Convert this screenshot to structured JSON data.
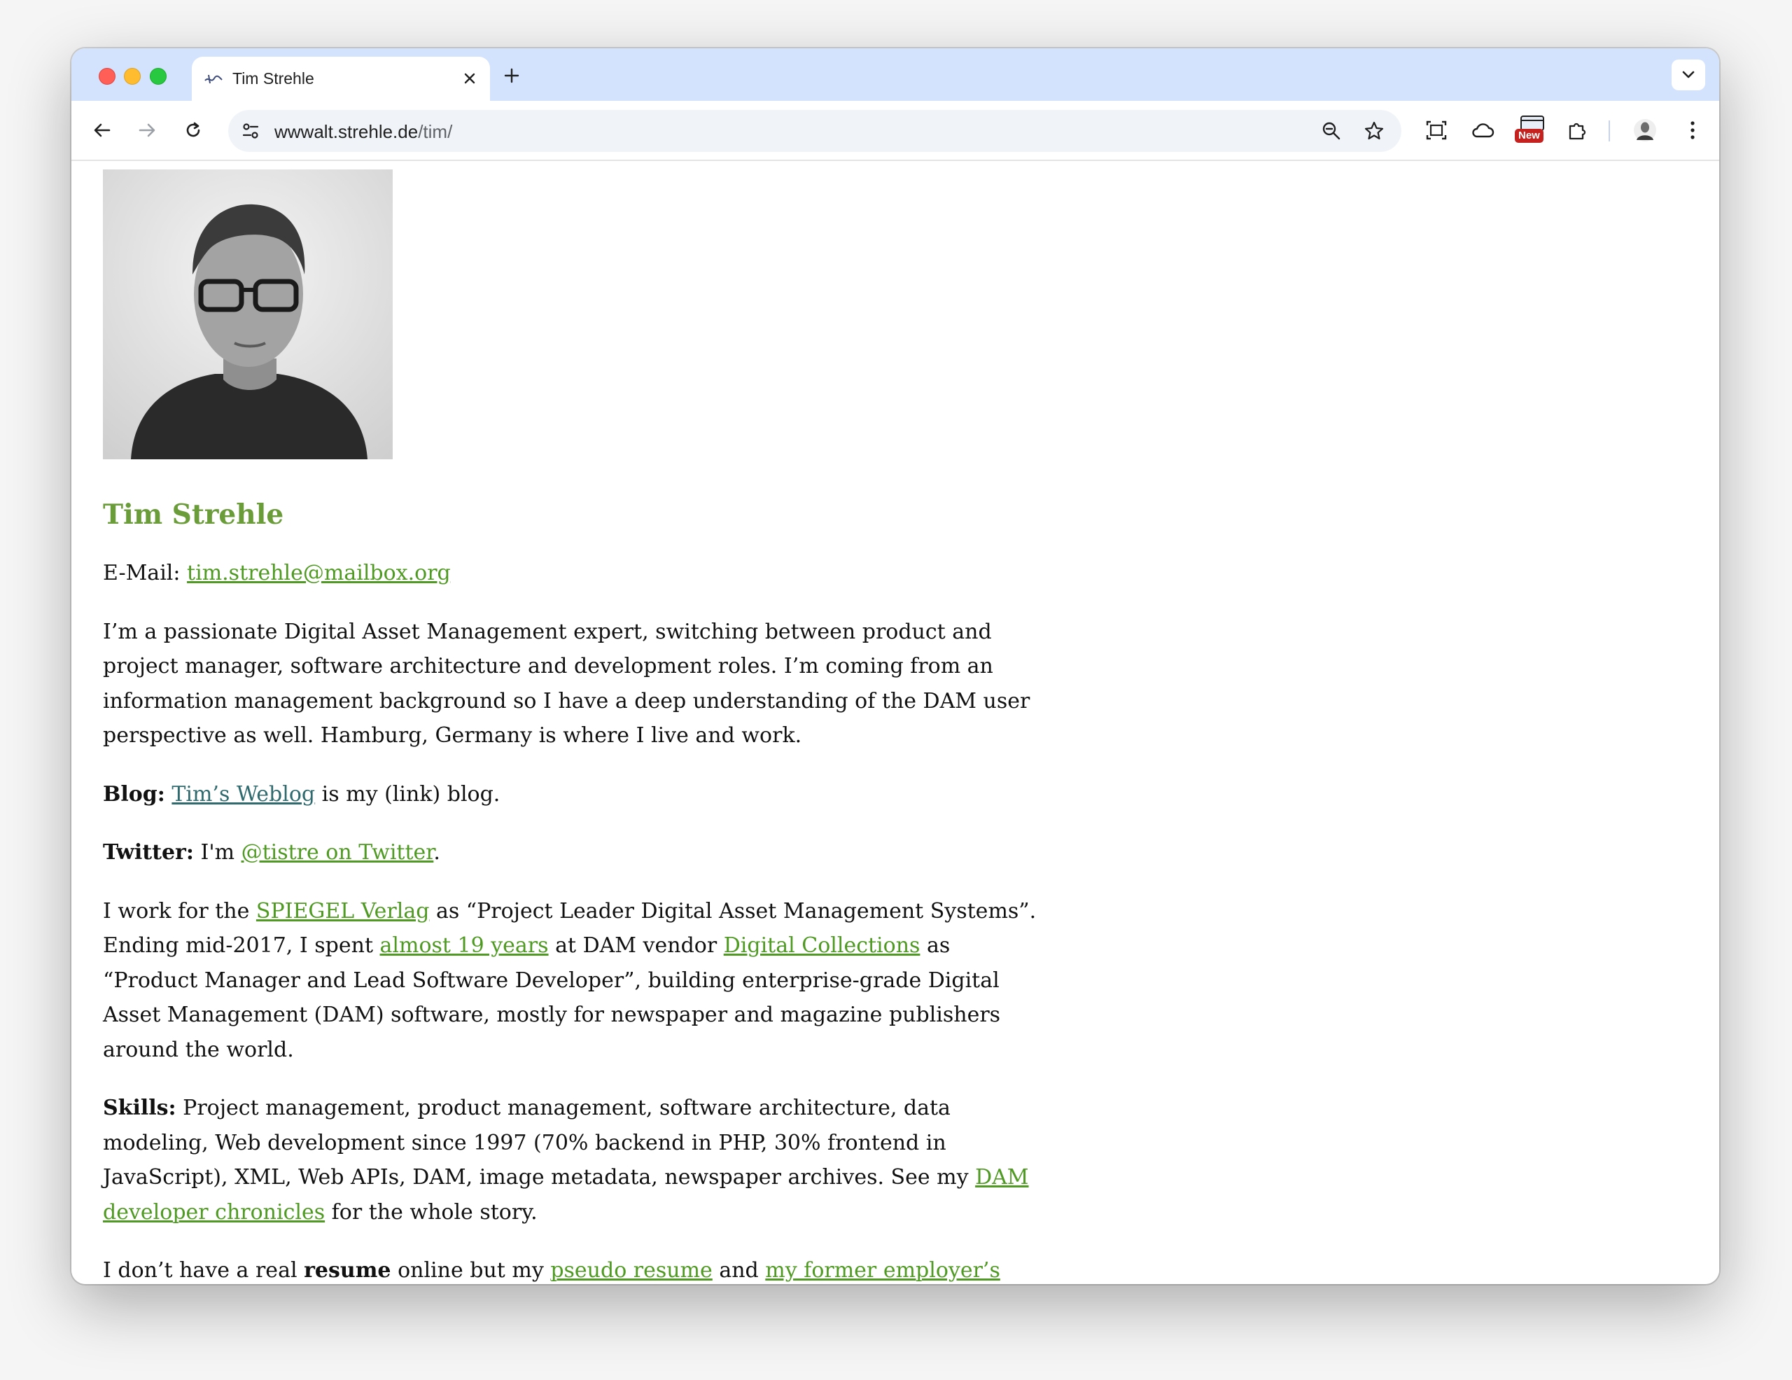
{
  "browser": {
    "tab_title": "Tim Strehle",
    "url_host": "wwwalt.strehle.de",
    "url_path": "/tim/",
    "extension_badge": "New"
  },
  "page": {
    "heading": "Tim Strehle",
    "email_label": "E-Mail:",
    "email_link": "tim.strehle@mailbox.org",
    "intro": "I’m a passionate Digital Asset Management expert, switching between product and project manager, software architecture and development roles. I’m coming from an information management background so I have a deep understanding of the DAM user perspective as well. Hamburg, Germany is where I live and work.",
    "blog_label": "Blog:",
    "blog_link": "Tim’s Weblog",
    "blog_rest": " is my (link) blog.",
    "twitter_label": "Twitter:",
    "twitter_pre": " I'm ",
    "twitter_link": "@tistre on Twitter",
    "twitter_post": ".",
    "work_1": "I work for the ",
    "work_link_spiegel": "SPIEGEL Verlag",
    "work_2": " as “Project Leader Digital Asset Management Systems”. Ending mid-2017, I spent ",
    "work_link_years": "almost 19 years",
    "work_3": " at DAM vendor ",
    "work_link_dc": "Digital Collections",
    "work_4": " as “Product Manager and Lead Software Developer”, building enterprise-grade Digital Asset Management (DAM) software, mostly for newspaper and magazine publishers around the world.",
    "skills_label": "Skills:",
    "skills_text": " Project management, product management, software architecture, data modeling, Web development since 1997 (70% backend in PHP, 30% frontend in JavaScript), XML, Web APIs, DAM, image metadata, newspaper archives. See my ",
    "skills_link": "DAM developer chronicles",
    "skills_end": " for the whole story.",
    "resume_1": "I don’t have a real ",
    "resume_bold": "resume",
    "resume_2": " online but my ",
    "resume_link_1": "pseudo resume",
    "resume_3": " and ",
    "resume_link_2": "my former employer’s"
  },
  "colors": {
    "heading": "#6b9c3a",
    "link": "#4f9a22",
    "blog_link": "#2f6a6e",
    "tab_strip": "#d3e3fd"
  }
}
